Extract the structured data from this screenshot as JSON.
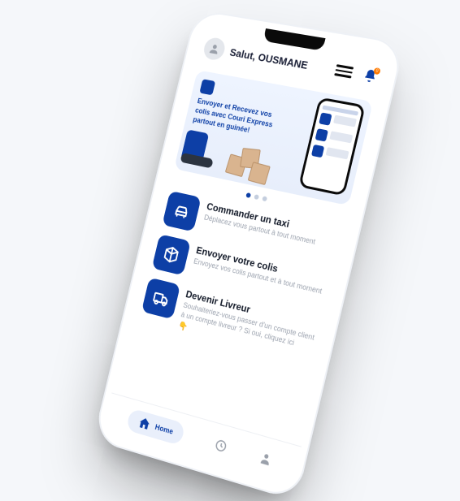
{
  "header": {
    "greeting": "Salut, OUSMANE",
    "notification_count": "0"
  },
  "banner": {
    "title": "Envoyer et Recevez vos colis avec Couri Express partout en guinée!"
  },
  "actions": [
    {
      "title": "Commander un taxi",
      "desc": "Déplacez vous partout à tout moment"
    },
    {
      "title": "Envoyer votre colis",
      "desc": "Envoyez vos colis partout et à tout moment"
    },
    {
      "title": "Devenir Livreur",
      "desc": "Souhaiteriez-vous passer d'un compte client à un compte livreur ? Si oui, cliquez ici",
      "hint": "👇"
    }
  ],
  "nav": {
    "home_label": "Home"
  }
}
